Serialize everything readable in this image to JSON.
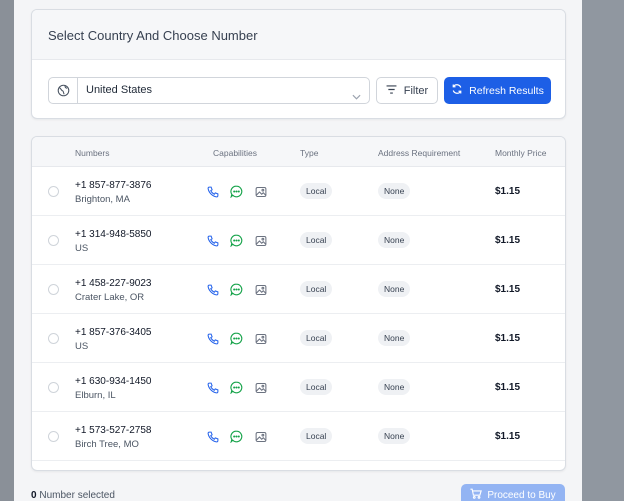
{
  "header": {
    "title": "Select Country And Choose Number"
  },
  "country": {
    "value": "United States"
  },
  "toolbar": {
    "filter_label": "Filter",
    "refresh_label": "Refresh Results"
  },
  "table": {
    "columns": [
      "Numbers",
      "Capabilities",
      "Type",
      "Address Requirement",
      "Monthly Price"
    ],
    "rows": [
      {
        "number": "+1 857-877-3876",
        "location": "Brighton, MA",
        "type": "Local",
        "address": "None",
        "price": "$1.15"
      },
      {
        "number": "+1 314-948-5850",
        "location": "US",
        "type": "Local",
        "address": "None",
        "price": "$1.15"
      },
      {
        "number": "+1 458-227-9023",
        "location": "Crater Lake, OR",
        "type": "Local",
        "address": "None",
        "price": "$1.15"
      },
      {
        "number": "+1 857-376-3405",
        "location": "US",
        "type": "Local",
        "address": "None",
        "price": "$1.15"
      },
      {
        "number": "+1 630-934-1450",
        "location": "Elburn, IL",
        "type": "Local",
        "address": "None",
        "price": "$1.15"
      },
      {
        "number": "+1 573-527-2758",
        "location": "Birch Tree, MO",
        "type": "Local",
        "address": "None",
        "price": "$1.15"
      }
    ]
  },
  "footer": {
    "count": "0",
    "count_label": "Number selected",
    "proceed_label": "Proceed to Buy"
  },
  "icons": {
    "globe": "globe-icon",
    "chevron": "chevron-down-icon",
    "filter": "filter-icon",
    "refresh": "refresh-icon",
    "phone": "phone-icon",
    "sms": "message-icon",
    "mms": "image-icon",
    "cart": "cart-icon"
  },
  "colors": {
    "primary": "#1d5fe6",
    "primary_disabled": "#93b4f3",
    "voice": "#2563eb",
    "sms": "#16a34a",
    "mms": "#6b7280"
  }
}
